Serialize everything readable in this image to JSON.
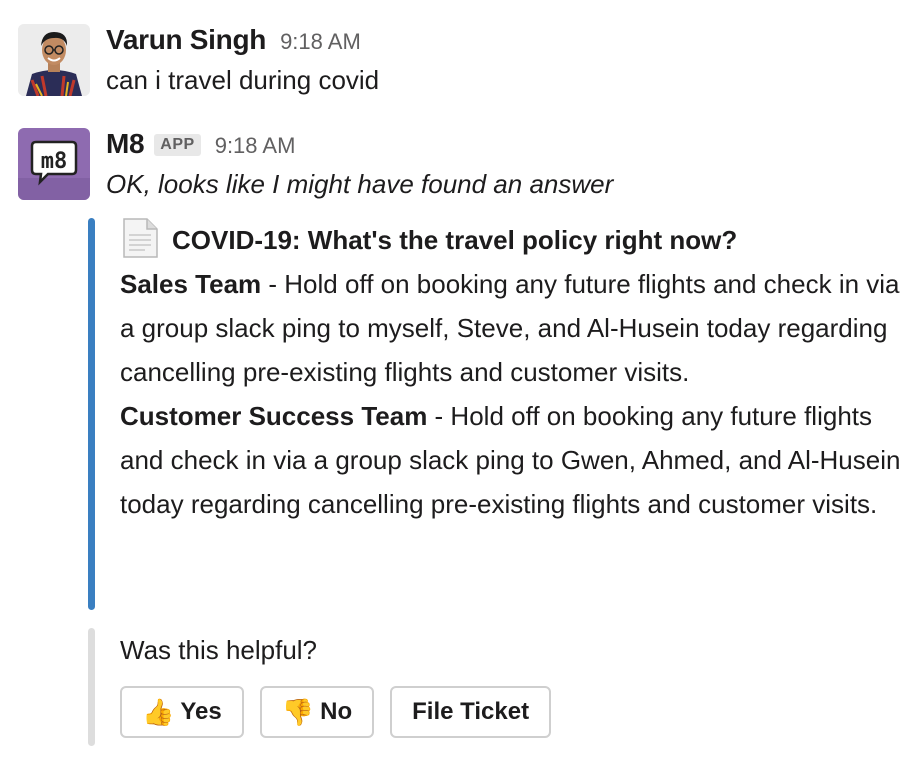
{
  "messages": [
    {
      "sender": "Varun Singh",
      "time": "9:18 AM",
      "text": "can i travel during covid"
    },
    {
      "sender": "M8",
      "badge": "APP",
      "time": "9:18 AM",
      "text": "OK, looks like I might have found an answer",
      "avatar_label": "m8"
    }
  ],
  "attachment": {
    "title": "COVID-19: What's the travel policy right now?",
    "accent_color": "#3a7fc1",
    "paragraphs": [
      {
        "bold": "Sales Team",
        "text": " - Hold off on booking any future flights and check in via a group slack ping to myself, Steve, and Al-Husein today regarding cancelling pre-existing flights and customer visits."
      },
      {
        "bold": "Customer Success Team",
        "text": " - Hold off on booking any future flights and check in via a group slack ping to Gwen, Ahmed, and Al-Husein today regarding cancelling pre-existing flights and customer visits."
      }
    ]
  },
  "feedback": {
    "question": "Was this helpful?",
    "bar_color": "#dddddd",
    "buttons": [
      {
        "emoji": "👍",
        "label": "Yes"
      },
      {
        "emoji": "👎",
        "label": "No"
      },
      {
        "label": "File Ticket"
      }
    ]
  },
  "colors": {
    "m8_avatar_bg": "#8e6bb0"
  }
}
